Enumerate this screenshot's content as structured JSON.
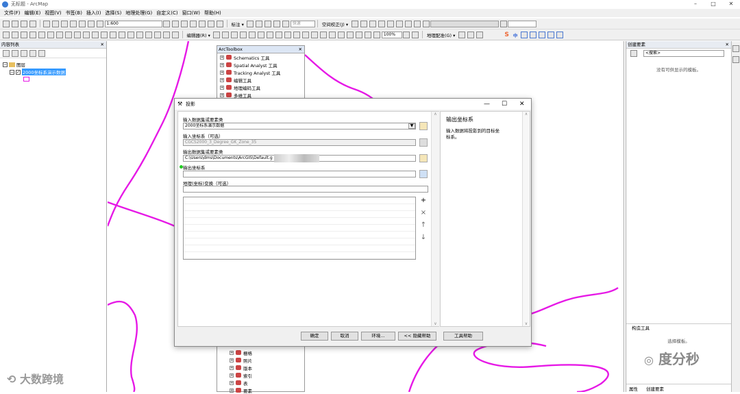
{
  "app": {
    "title": "无标题 - ArcMap",
    "min": "–",
    "max": "□",
    "close": "✕"
  },
  "menu": [
    "文件(F)",
    "编辑(E)",
    "视图(V)",
    "书签(B)",
    "插入(I)",
    "选择(S)",
    "地理处理(G)",
    "自定义(C)",
    "窗口(W)",
    "帮助(H)"
  ],
  "toolbar": {
    "scale": "1:600",
    "label_marker": "标注 ▾",
    "quick": "快速",
    "spatial_adjust": "空间校正(J) ▾",
    "editor": "编辑器(R) ▾",
    "georef": "地理配准(G) ▾",
    "zoom": "100%"
  },
  "toc": {
    "title": "内容列表",
    "close": "✕",
    "layers_label": "图层",
    "layer_name": "2000坐标系演示数据"
  },
  "arctoolbox": {
    "title": "ArcToolbox",
    "close": "✕",
    "items": [
      "Schematics 工具",
      "Spatial Analyst 工具",
      "Tracking Analyst 工具",
      "编辑工具",
      "地理编码工具",
      "多维工具"
    ],
    "bottom_items": [
      "栅格",
      "照片",
      "版本",
      "索引",
      "表",
      "要素"
    ]
  },
  "right": {
    "title": "创建要素",
    "search": "<搜索>",
    "empty": "没有可供显示的模板。",
    "construct_title": "构造工具",
    "construct_hint": "选择模板。",
    "tab_props": "属性",
    "tab_create": "创建要素"
  },
  "dialog": {
    "title": "投影",
    "min": "—",
    "max": "☐",
    "close": "✕",
    "in_label": "输入数据集或要素类",
    "in_value": "2000坐标系演示数据",
    "in_cs_label": "输入坐标系（可选）",
    "in_cs_value": "CGCS2000_3_Degree_GK_Zone_35",
    "out_label": "输出数据集或要素类",
    "out_value": "C:\\Users\\dms\\Documents\\ArcGIS\\Default.g",
    "out_cs_label": "输出坐标系",
    "transform_label": "地理(坐标)变换（可选）",
    "help_title": "输出坐标系",
    "help_text": "输入数据将投影到的目标坐标系。",
    "btn_ok": "确定",
    "btn_cancel": "取消",
    "btn_env": "环境...",
    "btn_hide": "<< 隐藏帮助",
    "btn_tool_help": "工具帮助"
  },
  "ime": {
    "s": "S",
    "zh": "中"
  },
  "watermarks": {
    "left": "大数跨境",
    "right": "度分秒"
  },
  "colors": {
    "line": "#e619e6",
    "accent": "#3399ff"
  }
}
